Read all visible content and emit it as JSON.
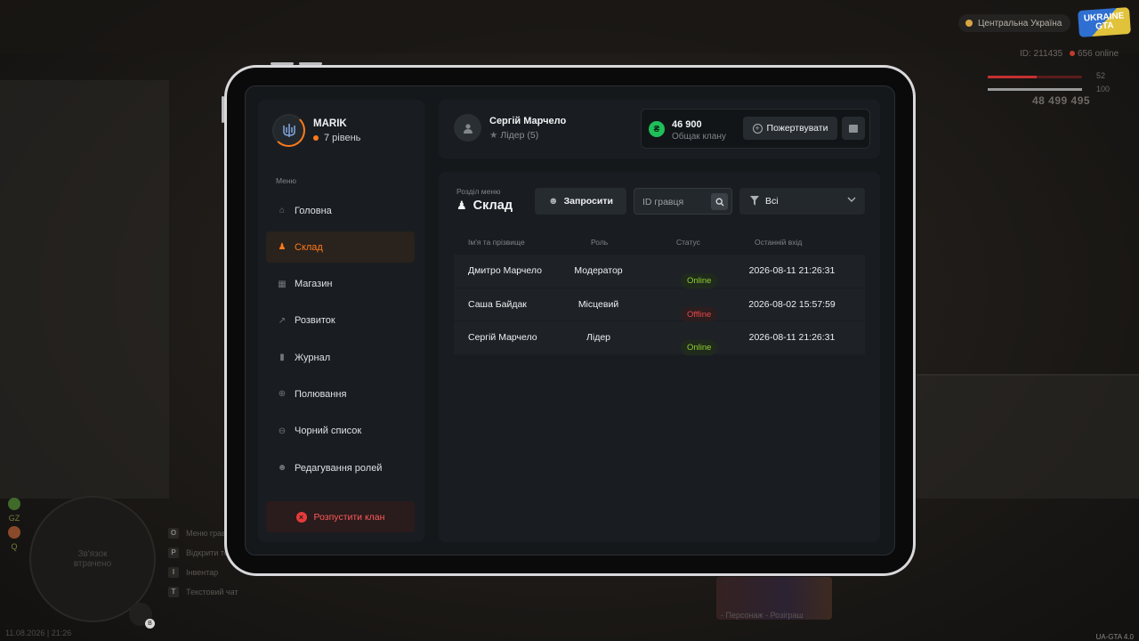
{
  "hud": {
    "region": "Центральна Україна",
    "logo_line1": "UKRAINE",
    "logo_line2": "GTA",
    "player_id": "ID: 211435",
    "online": "656 online",
    "health": "52",
    "armor": "100",
    "health_fraction": 0.52,
    "armor_fraction": 1.0,
    "money": "48 499 495",
    "map_text_1": "Зв'язок",
    "map_text_2": "втрачено",
    "map_letters": [
      "GZ",
      "Q"
    ],
    "hotkeys": [
      {
        "key": "O",
        "label": "Меню гравця"
      },
      {
        "key": "P",
        "label": "Відкрити телефон"
      },
      {
        "key": "I",
        "label": "Інвентар"
      },
      {
        "key": "T",
        "label": "Текстовий чат"
      }
    ],
    "mic_key": "B",
    "datetime": "11.08.2026 | 21:26",
    "promo_caption": "- Персонаж - Розіграш",
    "version": "UA-GTA 4.0"
  },
  "colors": {
    "accent": "#ff7a1a",
    "online": "#8fcf2e",
    "offline": "#e5484d",
    "money": "#1fbf5a",
    "danger": "#e63b3b"
  },
  "sidebar": {
    "profile_name": "MARIK",
    "profile_level": "7 рівень",
    "menu_caption": "Меню",
    "items": [
      {
        "label": "Головна",
        "icon": "home-icon"
      },
      {
        "label": "Склад",
        "icon": "members-icon",
        "active": true
      },
      {
        "label": "Магазин",
        "icon": "shop-icon"
      },
      {
        "label": "Розвиток",
        "icon": "chart-icon"
      },
      {
        "label": "Журнал",
        "icon": "book-icon"
      },
      {
        "label": "Полювання",
        "icon": "crosshair-icon"
      },
      {
        "label": "Чорний список",
        "icon": "block-icon"
      },
      {
        "label": "Редагування ролей",
        "icon": "user-edit-icon"
      }
    ],
    "disband_label": "Розпустити клан"
  },
  "header": {
    "leader_name": "Сергій Марчело",
    "leader_role": "Лідер (5)",
    "fund_amount": "46 900",
    "fund_label": "Общак клану",
    "donate_label": "Пожертвувати"
  },
  "section": {
    "caption": "Розділ меню",
    "title": "Склад",
    "invite_label": "Запросити",
    "search_placeholder": "ID гравця",
    "filter_value": "Всі"
  },
  "table": {
    "headers": [
      "Ім'я та прізвище",
      "Роль",
      "Статус",
      "Останній вхід"
    ],
    "rows": [
      {
        "name": "Дмитро Марчело",
        "role": "Модератор",
        "status": "Online",
        "last": "2026-08-11 21:26:31"
      },
      {
        "name": "Саша Байдак",
        "role": "Місцевий",
        "status": "Offline",
        "last": "2026-08-02 15:57:59"
      },
      {
        "name": "Сергій Марчело",
        "role": "Лідер",
        "status": "Online",
        "last": "2026-08-11 21:26:31"
      }
    ]
  }
}
